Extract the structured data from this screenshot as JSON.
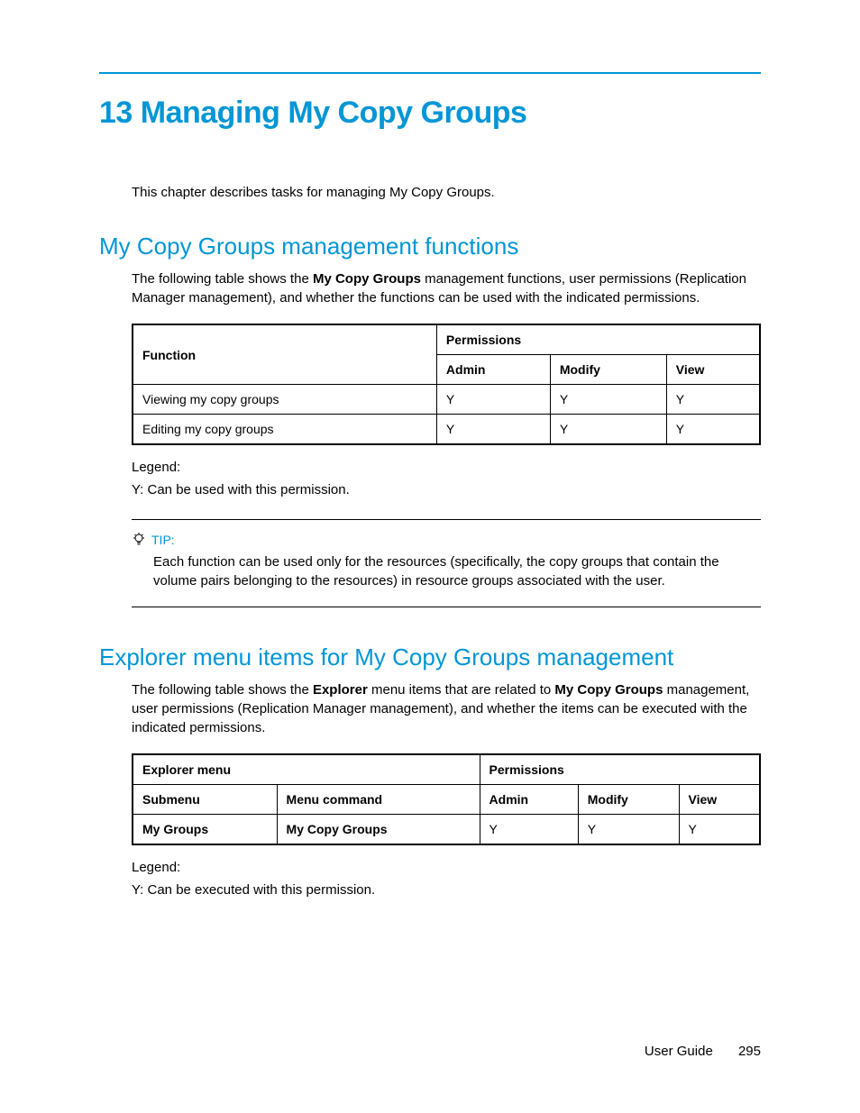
{
  "chapter": {
    "title": "13 Managing My Copy Groups",
    "intro": "This chapter describes tasks for managing My Copy Groups."
  },
  "section1": {
    "title": "My Copy Groups management functions",
    "para_pre": "The following table shows the ",
    "para_bold": "My Copy Groups",
    "para_post": " management functions, user permissions (Replication Manager management), and whether the functions can be used with the indicated permissions.",
    "table": {
      "h_function": "Function",
      "h_permissions": "Permissions",
      "h_admin": "Admin",
      "h_modify": "Modify",
      "h_view": "View",
      "rows": [
        {
          "fn": "Viewing my copy groups",
          "admin": "Y",
          "modify": "Y",
          "view": "Y"
        },
        {
          "fn": "Editing my copy groups",
          "admin": "Y",
          "modify": "Y",
          "view": "Y"
        }
      ]
    },
    "legend_label": "Legend:",
    "legend_text": "Y: Can be used with this permission."
  },
  "tip": {
    "label": "TIP:",
    "body": "Each function can be used only for the resources (specifically, the copy groups that contain the volume pairs belonging to the resources) in resource groups associated with the user."
  },
  "section2": {
    "title": "Explorer menu items for My Copy Groups management",
    "para_pre": "The following table shows the ",
    "para_bold1": "Explorer",
    "para_mid": " menu items that are related to ",
    "para_bold2": "My Copy Groups",
    "para_post": " management, user permissions (Replication Manager management), and whether the items can be executed with the indicated permissions.",
    "table": {
      "h_explorer": "Explorer menu",
      "h_permissions": "Permissions",
      "h_submenu": "Submenu",
      "h_command": "Menu command",
      "h_admin": "Admin",
      "h_modify": "Modify",
      "h_view": "View",
      "rows": [
        {
          "submenu": "My Groups",
          "command": "My Copy Groups",
          "admin": "Y",
          "modify": "Y",
          "view": "Y"
        }
      ]
    },
    "legend_label": "Legend:",
    "legend_text": "Y: Can be executed with this permission."
  },
  "footer": {
    "doc": "User Guide",
    "page": "295"
  }
}
